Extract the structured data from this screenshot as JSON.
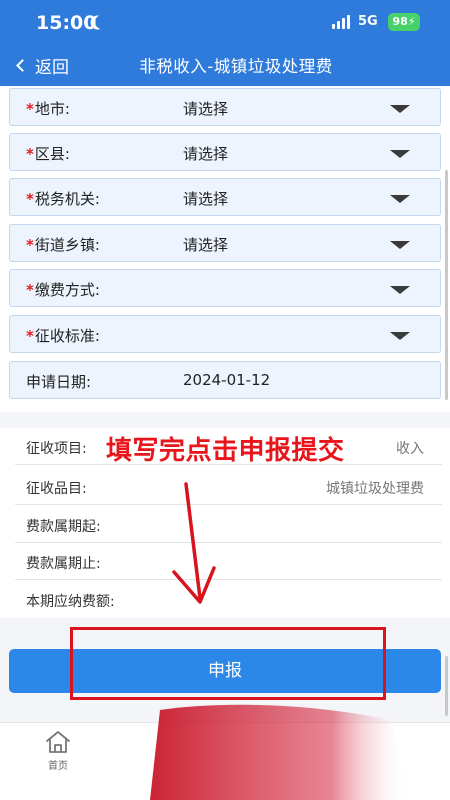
{
  "status_bar": {
    "time": "15:00",
    "network": "5G",
    "battery": "98"
  },
  "header": {
    "back_label": "返回",
    "title": "非税收入-城镇垃圾处理费"
  },
  "form": {
    "required_mark": "*",
    "fields": [
      {
        "label": "地市:",
        "value": "请选择",
        "required": true,
        "dropdown": true
      },
      {
        "label": "区县:",
        "value": "请选择",
        "required": true,
        "dropdown": true
      },
      {
        "label": "税务机关:",
        "value": "请选择",
        "required": true,
        "dropdown": true
      },
      {
        "label": "街道乡镇:",
        "value": "请选择",
        "required": true,
        "dropdown": true
      },
      {
        "label": "缴费方式:",
        "value": "",
        "required": true,
        "dropdown": true
      },
      {
        "label": "征收标准:",
        "value": "",
        "required": true,
        "dropdown": true
      },
      {
        "label": "申请日期:",
        "value": "2024-01-12",
        "required": false,
        "dropdown": false
      }
    ]
  },
  "info": {
    "rows": [
      {
        "label": "征收项目:",
        "value": "收入"
      },
      {
        "label": "征收品目:",
        "value": "城镇垃圾处理费"
      },
      {
        "label": "费款属期起:",
        "value": ""
      },
      {
        "label": "费款属期止:",
        "value": ""
      },
      {
        "label": "本期应纳费额:",
        "value": ""
      }
    ]
  },
  "annotation": {
    "text": "填写完点击申报提交",
    "color": "#e8151b"
  },
  "submit": {
    "label": "申报"
  },
  "tabbar": {
    "home_label": "首页",
    "home_icon": "home-icon"
  },
  "colors": {
    "header": "#2f7bdc",
    "button": "#2b87e8",
    "field_bg": "#edf4fd",
    "required": "#e02020"
  }
}
